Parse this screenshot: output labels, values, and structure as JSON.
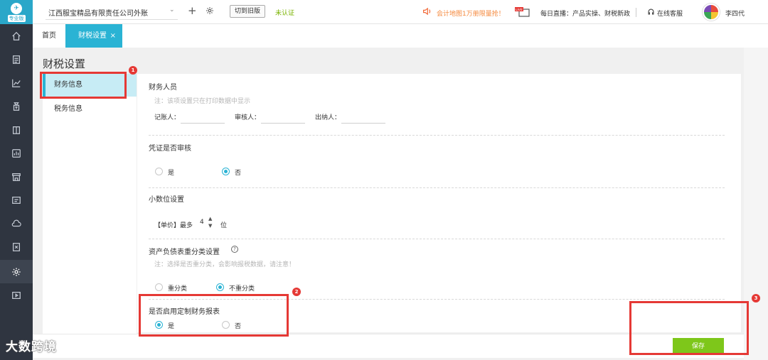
{
  "rail": {
    "logo_text": "专业版",
    "icons": [
      "home-icon",
      "voucher-icon",
      "chart-icon",
      "money-bag-icon",
      "book-icon",
      "report-icon",
      "store-icon",
      "invoice-icon",
      "cloud-icon",
      "tax-icon",
      "settings-icon",
      "video-icon"
    ],
    "active_index": 10
  },
  "topbar": {
    "company": "江西服宝精品有限责任公司外账",
    "switch_label": "切到旧版",
    "verify_status": "未认证",
    "promo": "会计地图1万册限量抢！",
    "live_badge": "LIVE",
    "live_text": "每日直播：产品实操、财税新政",
    "support": "在线客服",
    "user": "李四代"
  },
  "tabs": {
    "home": "首页",
    "active": "财税设置",
    "close": "×"
  },
  "page": {
    "title": "财税设置",
    "sidebar": [
      "财务信息",
      "税务信息"
    ]
  },
  "sections": {
    "staff": {
      "title": "财务人员",
      "note": "注：该项设置只在打印数据中显示",
      "bookkeeper": "记账人：",
      "reviewer": "审核人：",
      "cashier": "出纳人："
    },
    "voucher_review": {
      "title": "凭证是否审核",
      "yes": "是",
      "no": "否"
    },
    "decimal": {
      "title": "小数位设置",
      "prefix": "【单价】最多",
      "value": "4",
      "suffix": "位"
    },
    "reclass": {
      "title": "资产负债表重分类设置",
      "help": "?",
      "note": "注：选择是否重分类，会影响报税数据，请注意！",
      "opt1": "重分类",
      "opt2": "不重分类"
    },
    "custom_report": {
      "title": "是否启用定制财务报表",
      "yes": "是",
      "no": "否"
    }
  },
  "footer": {
    "save": "保存"
  },
  "annotations": [
    "1",
    "2",
    "3"
  ],
  "watermark": "大数跨境",
  "colors": {
    "accent": "#2ab3d4",
    "save": "#7ec71a",
    "annotation": "#e53935",
    "rail": "#2f3540"
  }
}
